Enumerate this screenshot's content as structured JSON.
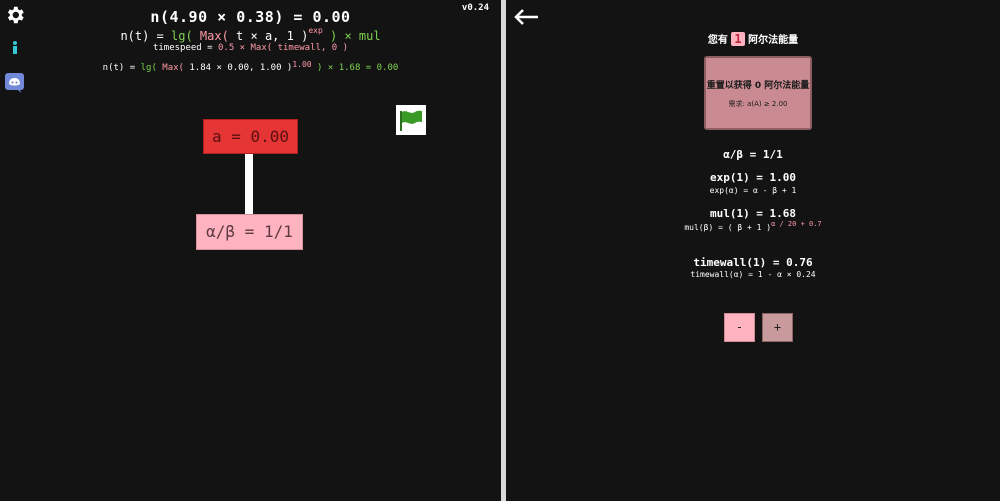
{
  "version": "v0.24",
  "header": {
    "n_value": "n(4.90 × 0.38) = 0.00",
    "formula_prefix": "n(t) = ",
    "formula_lg": "lg(",
    "formula_max": " Max(",
    "formula_inner": " t × a, 1 )",
    "formula_exp": "exp",
    "formula_suffix": " ) × mul",
    "timespeed_prefix": "timespeed = ",
    "timespeed_expr": "0.5 × Max( timewall, 0 )",
    "eval_prefix": "n(t) = ",
    "eval_lg": "lg(",
    "eval_max": " Max(",
    "eval_inner": " 1.84 × 0.00, 1.00 )",
    "eval_exp": "1.00",
    "eval_suffix": " ) × 1.68 = 0.00"
  },
  "tree": {
    "a_node": "a = 0.00",
    "ab_node": "α/β = 1/1"
  },
  "colors": {
    "a_node_bg": "#e63535",
    "ab_node_bg": "#ffb2c0",
    "reset_bg": "#c98b91",
    "minus_bg": "#ffb2c0",
    "plus_bg": "#c99a9c"
  },
  "icons": {
    "settings": "gear-icon",
    "info": "info-icon",
    "discord": "discord-icon",
    "flag": "flag-icon",
    "back": "back-arrow-icon"
  },
  "right": {
    "have_prefix": "您有",
    "have_count": "1",
    "have_suffix": "阿尔法能量",
    "reset_title": "重置以获得 0 阿尔法能量",
    "reset_req": "需求: a(A) ≥ 2.00",
    "ab_title": "α/β = 1/1",
    "exp_title": "exp(1) = 1.00",
    "exp_formula": "exp(α) = α - β + 1",
    "mul_title": "mul(1) = 1.68",
    "mul_formula_prefix": "mul(β) = ( β + 1 )",
    "mul_formula_exp": "α / 20 + 0.7",
    "timewall_title": "timewall(1) = 0.76",
    "timewall_formula": "timewall(α) = 1 - α × 0.24",
    "minus_label": "-",
    "plus_label": "+"
  }
}
